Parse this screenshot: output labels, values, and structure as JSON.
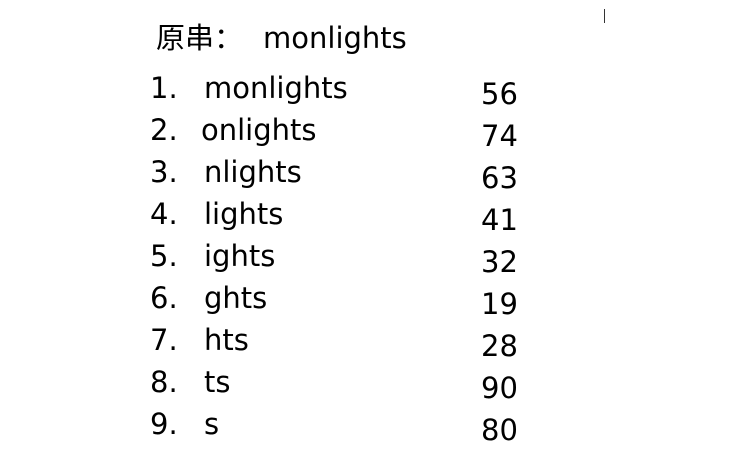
{
  "header": {
    "label": "原串：",
    "value": "monlights"
  },
  "suffixes": [
    {
      "index": "1.",
      "text": "monlights",
      "value": "56"
    },
    {
      "index": "2.",
      "text": "onlights",
      "value": "74"
    },
    {
      "index": "3.",
      "text": "nlights",
      "value": "63"
    },
    {
      "index": "4.",
      "text": "lights",
      "value": "41"
    },
    {
      "index": "5.",
      "text": "ights",
      "value": "32"
    },
    {
      "index": "6.",
      "text": "ghts",
      "value": "19"
    },
    {
      "index": "7.",
      "text": "hts",
      "value": "28"
    },
    {
      "index": "8.",
      "text": "ts",
      "value": "90"
    },
    {
      "index": "9.",
      "text": "s",
      "value": "80"
    }
  ]
}
